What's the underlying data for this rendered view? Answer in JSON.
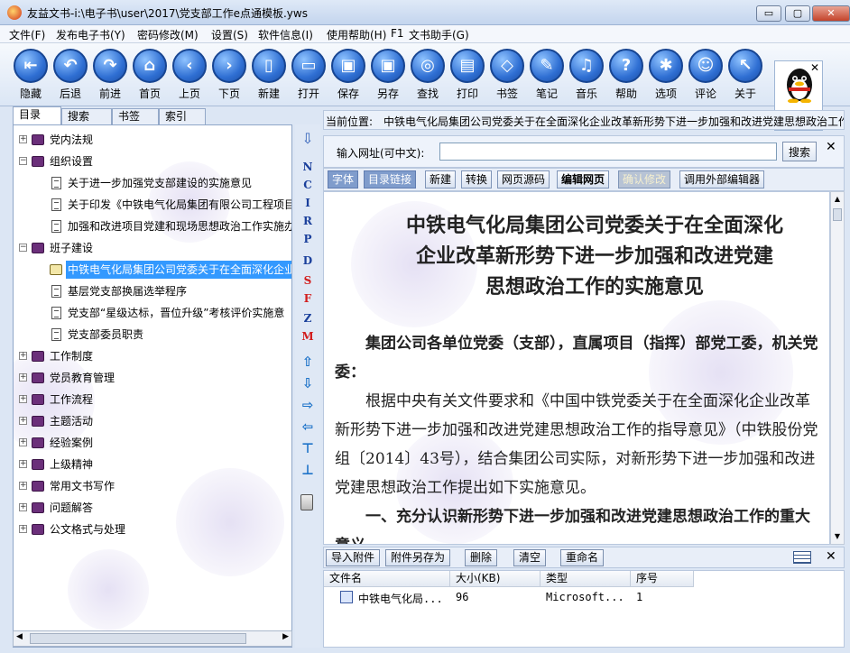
{
  "window": {
    "title": "友益文书-i:\\电子书\\user\\2017\\党支部工作e点通模板.yws",
    "minimize_glyph": "▭",
    "maximize_glyph": "▢",
    "close_glyph": "✕"
  },
  "menu": [
    "文件(F)",
    "发布电子书(Y)",
    "密码修改(M)",
    "设置(S)",
    "软件信息(I)",
    "使用帮助(H)",
    "F1",
    "文书助手(G)"
  ],
  "toolbar": [
    {
      "label": "隐藏",
      "icon": "hide-icon",
      "glyph": "⇤"
    },
    {
      "label": "后退",
      "icon": "back-icon",
      "glyph": "↶"
    },
    {
      "label": "前进",
      "icon": "forward-icon",
      "glyph": "↷"
    },
    {
      "label": "首页",
      "icon": "home-icon",
      "glyph": "⌂"
    },
    {
      "label": "上页",
      "icon": "prev-page-icon",
      "glyph": "‹"
    },
    {
      "label": "下页",
      "icon": "next-page-icon",
      "glyph": "›"
    },
    {
      "label": "新建",
      "icon": "new-doc-icon",
      "glyph": "▯"
    },
    {
      "label": "打开",
      "icon": "open-folder-icon",
      "glyph": "▭"
    },
    {
      "label": "保存",
      "icon": "save-icon",
      "glyph": "▣"
    },
    {
      "label": "另存",
      "icon": "save-as-icon",
      "glyph": "▣"
    },
    {
      "label": "查找",
      "icon": "binoculars-icon",
      "glyph": "◎"
    },
    {
      "label": "打印",
      "icon": "print-icon",
      "glyph": "▤"
    },
    {
      "label": "书签",
      "icon": "bookmark-tag-icon",
      "glyph": "◇"
    },
    {
      "label": "笔记",
      "icon": "note-pen-icon",
      "glyph": "✎"
    },
    {
      "label": "音乐",
      "icon": "music-icon",
      "glyph": "♫"
    },
    {
      "label": "帮助",
      "icon": "help-icon",
      "glyph": "?"
    },
    {
      "label": "选项",
      "icon": "gear-icon",
      "glyph": "✱"
    },
    {
      "label": "评论",
      "icon": "smiley-icon",
      "glyph": "☺"
    },
    {
      "label": "关于",
      "icon": "cursor-icon",
      "glyph": "↖"
    }
  ],
  "qq": {
    "label": "咨询",
    "close": "✕"
  },
  "left_tabs": [
    "目录",
    "搜索",
    "书签",
    "索引"
  ],
  "tree": [
    {
      "label": "党内法规",
      "type": "folder",
      "level": 0,
      "expander": "+"
    },
    {
      "label": "组织设置",
      "type": "folder",
      "level": 0,
      "expander": "−"
    },
    {
      "label": "关于进一步加强党支部建设的实施意见",
      "type": "doc",
      "level": 1
    },
    {
      "label": "关于印发《中铁电气化局集团有限公司工程项目",
      "type": "doc",
      "level": 1
    },
    {
      "label": "加强和改进项目党建和现场思想政治工作实施办",
      "type": "doc",
      "level": 1
    },
    {
      "label": "班子建设",
      "type": "folder",
      "level": 0,
      "expander": "−"
    },
    {
      "label": "中铁电气化局集团公司党委关于在全面深化企业",
      "type": "open-book",
      "level": 1,
      "selected": true
    },
    {
      "label": "基层党支部换届选举程序",
      "type": "doc",
      "level": 1
    },
    {
      "label": "党支部“星级达标，晋位升级”考核评价实施意",
      "type": "doc",
      "level": 1
    },
    {
      "label": "党支部委员职责",
      "type": "doc",
      "level": 1
    },
    {
      "label": "工作制度",
      "type": "folder",
      "level": 0,
      "expander": "+"
    },
    {
      "label": "党员教育管理",
      "type": "folder",
      "level": 0,
      "expander": "+"
    },
    {
      "label": "工作流程",
      "type": "folder",
      "level": 0,
      "expander": "+"
    },
    {
      "label": "主题活动",
      "type": "folder",
      "level": 0,
      "expander": "+"
    },
    {
      "label": "经验案例",
      "type": "folder",
      "level": 0,
      "expander": "+"
    },
    {
      "label": "上级精神",
      "type": "folder",
      "level": 0,
      "expander": "+"
    },
    {
      "label": "常用文书写作",
      "type": "folder",
      "level": 0,
      "expander": "+"
    },
    {
      "label": "问题解答",
      "type": "folder",
      "level": 0,
      "expander": "+"
    },
    {
      "label": "公文格式与处理",
      "type": "folder",
      "level": 0,
      "expander": "+"
    }
  ],
  "side_strip": [
    {
      "text": "N",
      "color": "blue"
    },
    {
      "text": "C",
      "color": "blue"
    },
    {
      "text": "I",
      "color": "blue"
    },
    {
      "text": "R",
      "color": "blue"
    },
    {
      "text": "P",
      "color": "blue"
    },
    {
      "text": "D",
      "color": "blue"
    },
    {
      "text": "S",
      "color": "red"
    },
    {
      "text": "F",
      "color": "red"
    },
    {
      "text": "Z",
      "color": "blue"
    },
    {
      "text": "M",
      "color": "red"
    },
    {
      "text": "⇧",
      "color": "arrow"
    },
    {
      "text": "⇩",
      "color": "arrow"
    },
    {
      "text": "⇨",
      "color": "arrow"
    },
    {
      "text": "⇦",
      "color": "arrow"
    },
    {
      "text": "⊤",
      "color": "arrow"
    },
    {
      "text": "⊥",
      "color": "arrow"
    }
  ],
  "location": {
    "label": "当前位置:",
    "path": "中铁电气化局集团公司党委关于在全面深化企业改革新形势下进一步加强和改进党建思想政治工作的实施意见"
  },
  "url_bar": {
    "label": "输入网址(可中文):",
    "value": "",
    "search": "搜索",
    "close": "✕"
  },
  "edit_buttons": [
    {
      "label": "字体",
      "state": "disabled"
    },
    {
      "label": "目录链接",
      "state": "disabled"
    },
    {
      "label": "新建",
      "state": "normal"
    },
    {
      "label": "转换",
      "state": "normal"
    },
    {
      "label": "网页源码",
      "state": "normal"
    },
    {
      "label": "编辑网页",
      "state": "bold"
    },
    {
      "label": "确认修改",
      "state": "faded"
    },
    {
      "label": "调用外部编辑器",
      "state": "normal"
    }
  ],
  "document": {
    "title_lines": [
      "中铁电气化局集团公司党委关于在全面深化",
      "企业改革新形势下进一步加强和改进党建",
      "思想政治工作的实施意见"
    ],
    "salutation": "　　集团公司各单位党委（支部），直属项目（指挥）部党工委，机关党委：",
    "paragraph1": "　　根据中央有关文件要求和《中国中铁党委关于在全面深化企业改革新形势下进一步加强和改进党建思想政治工作的指导意见》（中铁股份党组〔2014〕43号），结合集团公司实际，对新形势下进一步加强和改进党建思想政治工作提出如下实施意见。",
    "heading1": "　　一、充分认识新形势下进一步加强和改进党建思想政治工作的重大意义"
  },
  "attachments": {
    "buttons": [
      "导入附件",
      "附件另存为",
      "删除",
      "清空",
      "重命名"
    ],
    "close": "✕",
    "columns": [
      "文件名",
      "大小(KB)",
      "类型",
      "序号"
    ],
    "rows": [
      {
        "name": "中铁电气化局...",
        "size": "96",
        "type": "Microsoft...",
        "index": "1"
      }
    ]
  },
  "colors": {
    "selection": "#3399ff",
    "toolbar_button": "#2f6fd3",
    "book_icon": "#6b2f7a",
    "side_red": "#d21d1d",
    "side_blue": "#1a3f9b"
  }
}
